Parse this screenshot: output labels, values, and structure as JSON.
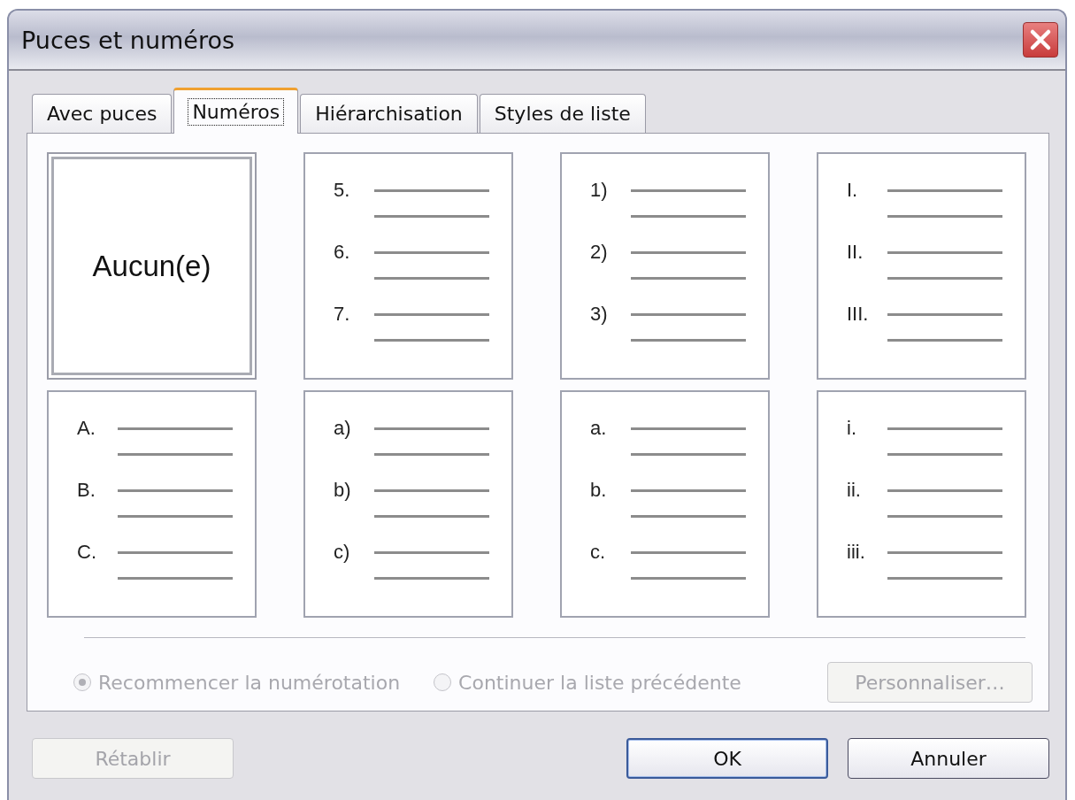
{
  "window": {
    "title": "Puces et numéros"
  },
  "tabs": [
    {
      "label": "Avec puces",
      "selected": false
    },
    {
      "label": "Numéros",
      "selected": true
    },
    {
      "label": "Hiérarchisation",
      "selected": false
    },
    {
      "label": "Styles de liste",
      "selected": false
    }
  ],
  "presets": [
    {
      "kind": "none",
      "label": "Aucun(e)",
      "selected": true
    },
    {
      "kind": "list",
      "markers": [
        "5.",
        "6.",
        "7."
      ],
      "selected": false
    },
    {
      "kind": "list",
      "markers": [
        "1)",
        "2)",
        "3)"
      ],
      "selected": false
    },
    {
      "kind": "list",
      "markers": [
        "I.",
        "II.",
        "III."
      ],
      "selected": false
    },
    {
      "kind": "list",
      "markers": [
        "A.",
        "B.",
        "C."
      ],
      "selected": false
    },
    {
      "kind": "list",
      "markers": [
        "a)",
        "b)",
        "c)"
      ],
      "selected": false
    },
    {
      "kind": "list",
      "markers": [
        "a.",
        "b.",
        "c."
      ],
      "selected": false
    },
    {
      "kind": "list",
      "markers": [
        "i.",
        "ii.",
        "iii."
      ],
      "selected": false
    }
  ],
  "options": [
    {
      "label": "Recommencer la numérotation",
      "checked": true,
      "disabled": true
    },
    {
      "label": "Continuer la liste précédente",
      "checked": false,
      "disabled": true
    }
  ],
  "customize_button": {
    "label": "Personnaliser…",
    "disabled": true
  },
  "buttons": [
    {
      "label": "Rétablir",
      "disabled": true,
      "default": false
    },
    {
      "label": "OK",
      "disabled": false,
      "default": true
    },
    {
      "label": "Annuler",
      "disabled": false,
      "default": false
    }
  ]
}
